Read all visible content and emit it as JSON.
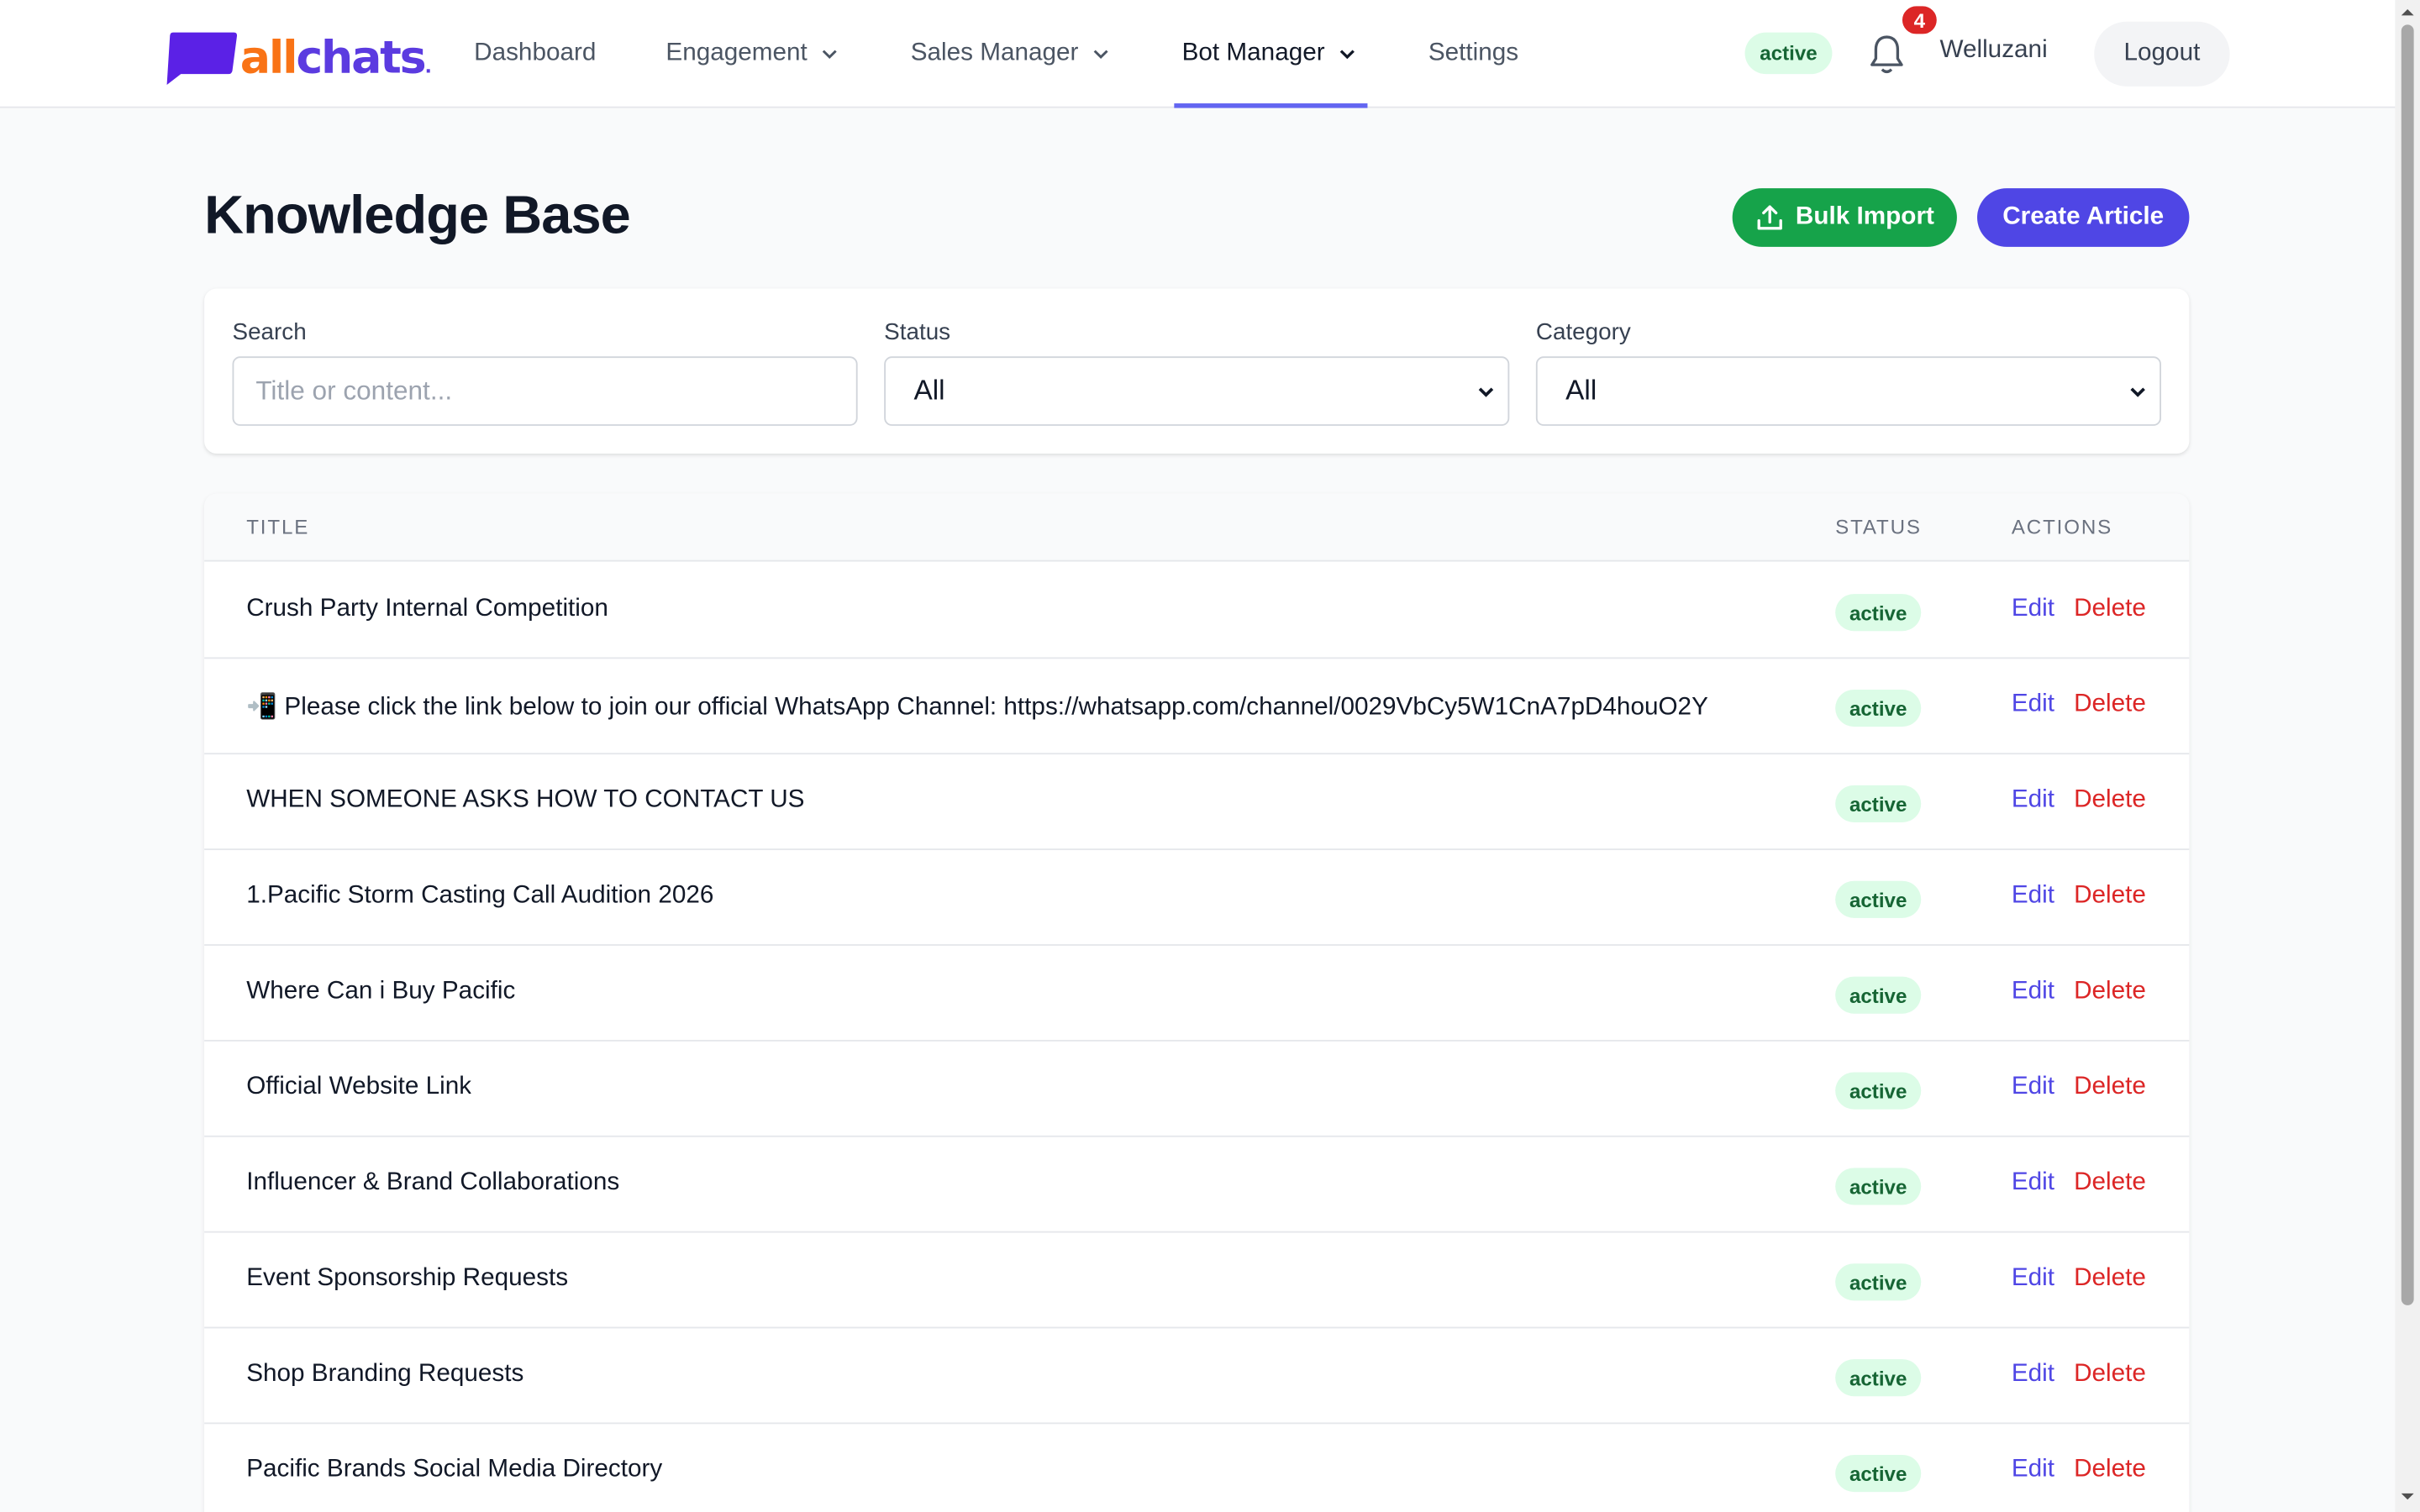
{
  "brand": {
    "name_part1": "all",
    "name_part2": "chats",
    "dot": "."
  },
  "nav": {
    "items": [
      {
        "label": "Dashboard",
        "dropdown": false
      },
      {
        "label": "Engagement",
        "dropdown": true
      },
      {
        "label": "Sales Manager",
        "dropdown": true
      },
      {
        "label": "Bot Manager",
        "dropdown": true,
        "active": true
      },
      {
        "label": "Settings",
        "dropdown": false
      }
    ]
  },
  "header": {
    "status_badge": "active",
    "notification_count": "4",
    "username": "Welluzani",
    "logout_label": "Logout"
  },
  "page": {
    "title": "Knowledge Base",
    "bulk_import_label": "Bulk Import",
    "create_article_label": "Create Article"
  },
  "filters": {
    "search_label": "Search",
    "search_placeholder": "Title or content...",
    "status_label": "Status",
    "status_value": "All",
    "category_label": "Category",
    "category_value": "All"
  },
  "table": {
    "columns": {
      "title": "TITLE",
      "status": "STATUS",
      "actions": "ACTIONS"
    },
    "edit_label": "Edit",
    "delete_label": "Delete",
    "rows": [
      {
        "title": "Crush Party Internal Competition",
        "status": "active"
      },
      {
        "title": "📲 Please click the link below to join our official WhatsApp Channel: https://whatsapp.com/channel/0029VbCy5W1CnA7pD4houO2Y",
        "status": "active"
      },
      {
        "title": "WHEN SOMEONE ASKS HOW TO CONTACT US",
        "status": "active"
      },
      {
        "title": "1.Pacific Storm Casting Call Audition 2026",
        "status": "active"
      },
      {
        "title": "Where Can i Buy Pacific",
        "status": "active"
      },
      {
        "title": "Official Website Link",
        "status": "active"
      },
      {
        "title": "Influencer & Brand Collaborations",
        "status": "active"
      },
      {
        "title": "Event Sponsorship Requests",
        "status": "active"
      },
      {
        "title": "Shop Branding Requests",
        "status": "active"
      },
      {
        "title": "Pacific Brands Social Media Directory",
        "status": "active"
      }
    ]
  },
  "colors": {
    "brand_orange": "#f97316",
    "brand_purple": "#5b3be0",
    "primary": "#4f46e5",
    "success": "#16a34a",
    "danger": "#dc2626",
    "badge_bg": "#dcfce7",
    "badge_text": "#166534"
  }
}
